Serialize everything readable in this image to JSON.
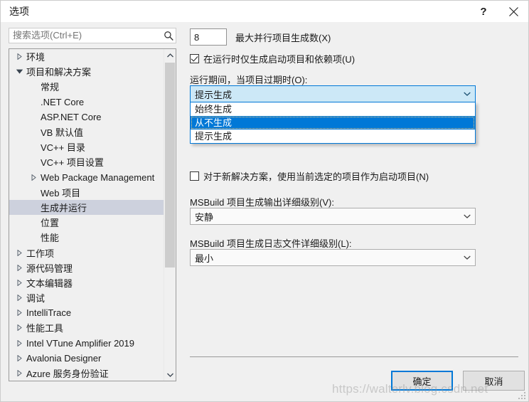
{
  "window": {
    "title": "选项",
    "help_button": "?",
    "close_button": "✕"
  },
  "search": {
    "placeholder": "搜索选项(Ctrl+E)",
    "value": "",
    "icon": "search-icon"
  },
  "tree": {
    "items": [
      {
        "label": "环境",
        "level": 0,
        "expander": "collapsed",
        "selected": false
      },
      {
        "label": "项目和解决方案",
        "level": 0,
        "expander": "expanded",
        "selected": false
      },
      {
        "label": "常规",
        "level": 1,
        "expander": "none",
        "selected": false
      },
      {
        "label": ".NET Core",
        "level": 1,
        "expander": "none",
        "selected": false
      },
      {
        "label": "ASP.NET Core",
        "level": 1,
        "expander": "none",
        "selected": false
      },
      {
        "label": "VB 默认值",
        "level": 1,
        "expander": "none",
        "selected": false
      },
      {
        "label": "VC++ 目录",
        "level": 1,
        "expander": "none",
        "selected": false
      },
      {
        "label": "VC++ 项目设置",
        "level": 1,
        "expander": "none",
        "selected": false
      },
      {
        "label": "Web Package Management",
        "level": 1,
        "expander": "collapsed",
        "selected": false
      },
      {
        "label": "Web 项目",
        "level": 1,
        "expander": "none",
        "selected": false
      },
      {
        "label": "生成并运行",
        "level": 1,
        "expander": "none",
        "selected": true
      },
      {
        "label": "位置",
        "level": 1,
        "expander": "none",
        "selected": false
      },
      {
        "label": "性能",
        "level": 1,
        "expander": "none",
        "selected": false
      },
      {
        "label": "工作项",
        "level": 0,
        "expander": "collapsed",
        "selected": false
      },
      {
        "label": "源代码管理",
        "level": 0,
        "expander": "collapsed",
        "selected": false
      },
      {
        "label": "文本编辑器",
        "level": 0,
        "expander": "collapsed",
        "selected": false
      },
      {
        "label": "调试",
        "level": 0,
        "expander": "collapsed",
        "selected": false
      },
      {
        "label": "IntelliTrace",
        "level": 0,
        "expander": "collapsed",
        "selected": false
      },
      {
        "label": "性能工具",
        "level": 0,
        "expander": "collapsed",
        "selected": false
      },
      {
        "label": "Intel VTune Amplifier 2019",
        "level": 0,
        "expander": "collapsed",
        "selected": false
      },
      {
        "label": "Avalonia Designer",
        "level": 0,
        "expander": "collapsed",
        "selected": false
      },
      {
        "label": "Azure 服务身份验证",
        "level": 0,
        "expander": "collapsed",
        "selected": false
      }
    ],
    "scrollbar": {
      "up_arrow": "▲",
      "down_arrow": "▼"
    }
  },
  "options": {
    "max_parallel_builds": {
      "value": "8",
      "label": "最大并行项目生成数(X)"
    },
    "only_build_startup": {
      "label": "在运行时仅生成启动项目和依赖项(U)",
      "checked": true
    },
    "on_run_outdated": {
      "label": "运行期间，当项目过期时(O):",
      "selected": "提示生成",
      "expanded": true,
      "options": [
        "始终生成",
        "从不生成",
        "提示生成"
      ],
      "highlighted": "从不生成"
    },
    "new_solution_startup": {
      "label": "对于新解决方案，使用当前选定的项目作为启动项目(N)",
      "checked": false
    },
    "msbuild_output_verbosity": {
      "label": "MSBuild 项目生成输出详细级别(V):",
      "selected": "安静"
    },
    "msbuild_log_verbosity": {
      "label": "MSBuild 项目生成日志文件详细级别(L):",
      "selected": "最小"
    }
  },
  "footer": {
    "ok_label": "确定",
    "cancel_label": "取消"
  },
  "watermark": {
    "text": "https://walterlv.blog.csdn.net"
  },
  "colors": {
    "accent": "#0078d7",
    "dialog_background": "#f0f0f0",
    "combo_focus_background": "#cce8f7",
    "tree_selection": "#cdd1dd",
    "dropdown_highlight": "#0078d7"
  }
}
